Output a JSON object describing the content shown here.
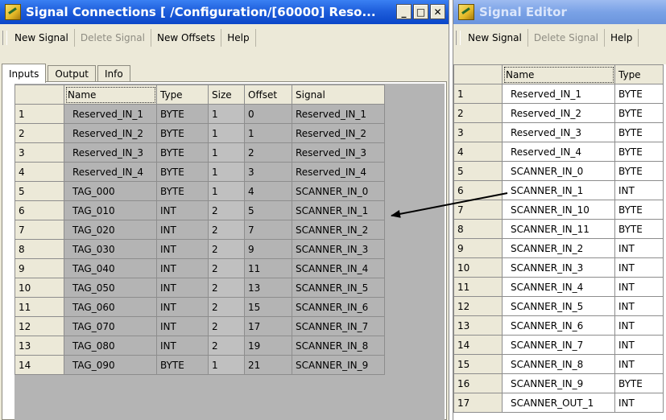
{
  "left_window": {
    "title": "Signal Connections  [ /Configuration/[60000] Reso...",
    "caption_buttons": [
      "_",
      "□",
      "✕"
    ],
    "menu": [
      "New Signal",
      "Delete Signal",
      "New Offsets",
      "Help"
    ],
    "menu_disabled": [
      false,
      true,
      false,
      false
    ],
    "tabs": [
      "Inputs",
      "Output",
      "Info"
    ],
    "active_tab": 0,
    "table": {
      "columns": [
        "",
        "Name",
        "Type",
        "Size",
        "Offset",
        "Signal"
      ],
      "rows": [
        [
          "1",
          "Reserved_IN_1",
          "BYTE",
          "1",
          "0",
          "Reserved_IN_1"
        ],
        [
          "2",
          "Reserved_IN_2",
          "BYTE",
          "1",
          "1",
          "Reserved_IN_2"
        ],
        [
          "3",
          "Reserved_IN_3",
          "BYTE",
          "1",
          "2",
          "Reserved_IN_3"
        ],
        [
          "4",
          "Reserved_IN_4",
          "BYTE",
          "1",
          "3",
          "Reserved_IN_4"
        ],
        [
          "5",
          "TAG_000",
          "BYTE",
          "1",
          "4",
          "SCANNER_IN_0"
        ],
        [
          "6",
          "TAG_010",
          "INT",
          "2",
          "5",
          "SCANNER_IN_1"
        ],
        [
          "7",
          "TAG_020",
          "INT",
          "2",
          "7",
          "SCANNER_IN_2"
        ],
        [
          "8",
          "TAG_030",
          "INT",
          "2",
          "9",
          "SCANNER_IN_3"
        ],
        [
          "9",
          "TAG_040",
          "INT",
          "2",
          "11",
          "SCANNER_IN_4"
        ],
        [
          "10",
          "TAG_050",
          "INT",
          "2",
          "13",
          "SCANNER_IN_5"
        ],
        [
          "11",
          "TAG_060",
          "INT",
          "2",
          "15",
          "SCANNER_IN_6"
        ],
        [
          "12",
          "TAG_070",
          "INT",
          "2",
          "17",
          "SCANNER_IN_7"
        ],
        [
          "13",
          "TAG_080",
          "INT",
          "2",
          "19",
          "SCANNER_IN_8"
        ],
        [
          "14",
          "TAG_090",
          "BYTE",
          "1",
          "21",
          "SCANNER_IN_9"
        ]
      ]
    }
  },
  "right_window": {
    "title": "Signal Editor",
    "menu": [
      "New Signal",
      "Delete Signal",
      "Help"
    ],
    "menu_disabled": [
      false,
      true,
      false
    ],
    "table": {
      "columns": [
        "",
        "Name",
        "Type"
      ],
      "rows": [
        [
          "1",
          "Reserved_IN_1",
          "BYTE"
        ],
        [
          "2",
          "Reserved_IN_2",
          "BYTE"
        ],
        [
          "3",
          "Reserved_IN_3",
          "BYTE"
        ],
        [
          "4",
          "Reserved_IN_4",
          "BYTE"
        ],
        [
          "5",
          "SCANNER_IN_0",
          "BYTE"
        ],
        [
          "6",
          "SCANNER_IN_1",
          "INT"
        ],
        [
          "7",
          "SCANNER_IN_10",
          "BYTE"
        ],
        [
          "8",
          "SCANNER_IN_11",
          "BYTE"
        ],
        [
          "9",
          "SCANNER_IN_2",
          "INT"
        ],
        [
          "10",
          "SCANNER_IN_3",
          "INT"
        ],
        [
          "11",
          "SCANNER_IN_4",
          "INT"
        ],
        [
          "12",
          "SCANNER_IN_5",
          "INT"
        ],
        [
          "13",
          "SCANNER_IN_6",
          "INT"
        ],
        [
          "14",
          "SCANNER_IN_7",
          "INT"
        ],
        [
          "15",
          "SCANNER_IN_8",
          "INT"
        ],
        [
          "16",
          "SCANNER_IN_9",
          "BYTE"
        ],
        [
          "17",
          "SCANNER_OUT_1",
          "INT"
        ]
      ]
    }
  },
  "colors": {
    "title_active": "#0a46c8",
    "title_inactive": "#7aa2e6",
    "window_bg": "#ece9d8",
    "size_cell_bg": "#c0c0c0",
    "grid_empty_bg": "#b4b4b4"
  }
}
